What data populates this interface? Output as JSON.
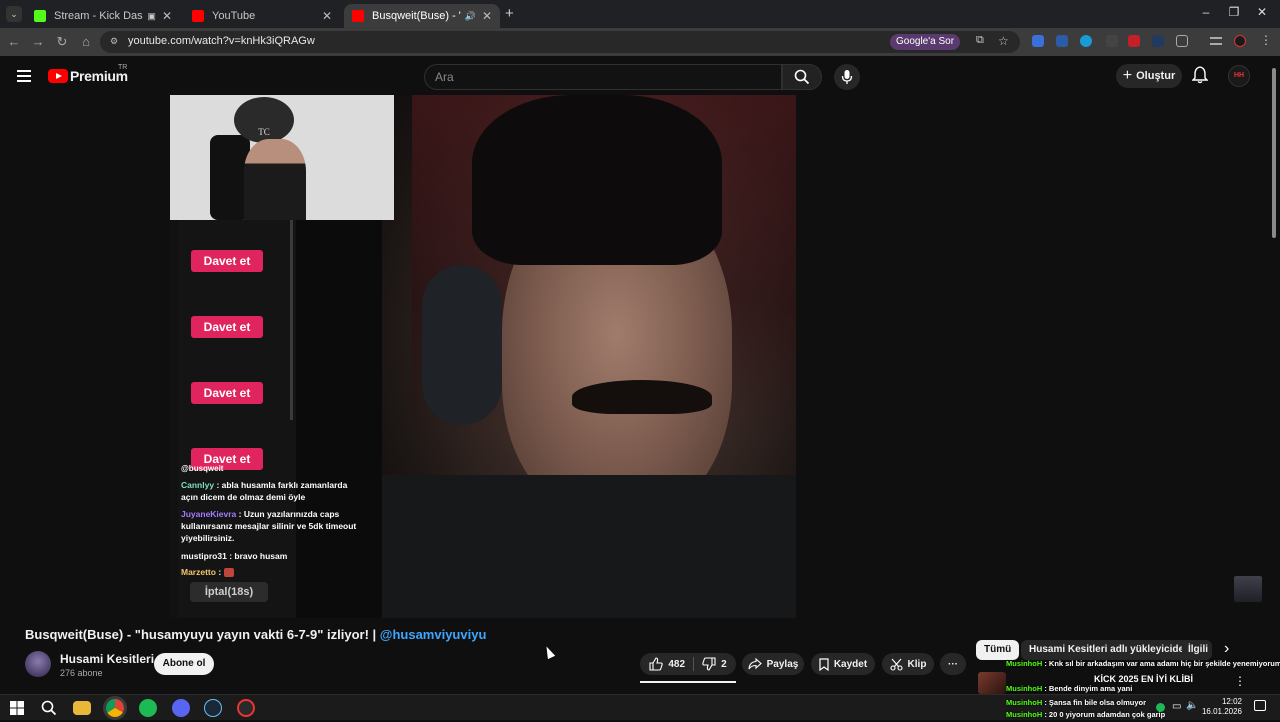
{
  "browser": {
    "tabs": [
      {
        "title": "Stream - Kick Dashboard",
        "favicon_color": "#53fc18"
      },
      {
        "title": "YouTube",
        "favicon_color": "#ff0000"
      },
      {
        "title": "Busqweit(Buse) - \"husamyu",
        "favicon_color": "#ff0000",
        "active": true
      }
    ],
    "new_tab": "+",
    "url": "youtube.com/watch?v=knHk3iQRAGw",
    "ask_google": "Google'a Sor",
    "window_controls": {
      "minimize": "–",
      "restore": "❐",
      "close": "✕"
    }
  },
  "youtube": {
    "logo_text": "Premium",
    "country_code": "TR",
    "search_placeholder": "Ara",
    "create_label": "Oluştur",
    "account_initials": "НН"
  },
  "player": {
    "invite_label": "Davet et",
    "overlay_handle": "@busqweit",
    "chat": [
      {
        "user": "Cannlyy",
        "user_color": "#7ee0c0",
        "text": " : abla husamla farklı zamanlarda açın dicem de olmaz demi öyle"
      },
      {
        "user": "JuyaneKievra",
        "user_color": "#a47cff",
        "text": " : Uzun yazılarınızda caps kullanırsanız mesajlar silinir ve 5dk timeout yiyebilirsiniz."
      },
      {
        "user": "mustipro31",
        "user_color": "#ffffff",
        "text": " : bravo husam"
      },
      {
        "user": "Marzetto",
        "user_color": "#f3c76b",
        "text": " : "
      }
    ],
    "cancel_label": "İptal(18s)",
    "mini_logo_text": "TC"
  },
  "video": {
    "title": "Busqweit(Buse) - \"husamyuyu yayın vakti 6-7-9\" izliyor! | ",
    "title_mention": "@husamviyuviyu",
    "channel_name": "Husami Kesitleri",
    "subscribers": "276 abone",
    "subscribe_label": "Abone ol",
    "likes": "482",
    "dislikes": "2",
    "share_label": "Paylaş",
    "save_label": "Kaydet",
    "clip_label": "Klip",
    "more_label": "···"
  },
  "sidebar": {
    "chips": [
      {
        "label": "Tümü",
        "active": true
      },
      {
        "label": "Husami Kesitleri adlı yükleyiciden",
        "active": false
      },
      {
        "label": "İlgili",
        "active": false
      }
    ],
    "next_chip": "›",
    "recommendation_title": "KİCK 2025 EN İYİ KLİBİ",
    "kick_overlay": [
      {
        "user": "MusinhoH",
        "text": " : Knk sıl bir arkadaşım var ama adamı hiç bir şekilde yenemiyorum"
      },
      {
        "user": "MusinhoH",
        "text": " : Bende dinyim ama yani"
      },
      {
        "user": "MusinhoH",
        "text": " : Şansa fin bile olsa olmuyor"
      },
      {
        "user": "MusinhoH",
        "text": " : 20 0 yiyorum adamdan çok garip"
      }
    ]
  },
  "taskbar": {
    "time": "12:02",
    "date": "16.01.2026"
  }
}
